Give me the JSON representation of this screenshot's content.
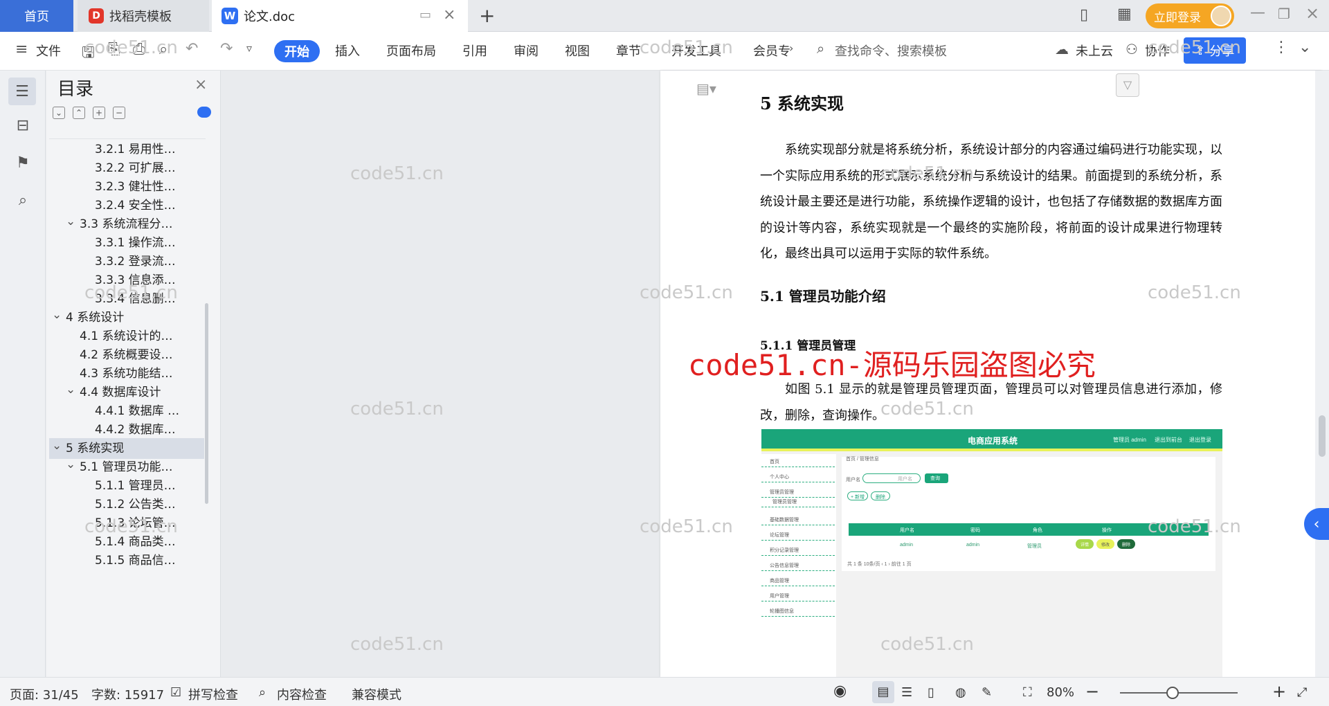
{
  "tabs": {
    "home": "首页",
    "daoke": "找稻壳模板",
    "doc": "论文.doc",
    "new_tab": "+",
    "login": "立即登录"
  },
  "toolbar": {
    "file_menu": "文件",
    "ribbon": [
      "开始",
      "插入",
      "页面布局",
      "引用",
      "审阅",
      "视图",
      "章节",
      "开发工具",
      "会员专"
    ],
    "search_placeholder": "查找命令、搜索模板",
    "cloud": "未上云",
    "collab": "协作",
    "share": "分享"
  },
  "toc": {
    "title": "目录",
    "items": [
      {
        "label": "3.2.1  易用性…",
        "level": 3
      },
      {
        "label": "3.2.2  可扩展…",
        "level": 3
      },
      {
        "label": "3.2.3  健壮性…",
        "level": 3
      },
      {
        "label": "3.2.4  安全性…",
        "level": 3
      },
      {
        "label": "3.3  系统流程分…",
        "level": 2,
        "expanded": true
      },
      {
        "label": "3.3.1  操作流…",
        "level": 3
      },
      {
        "label": "3.3.2  登录流…",
        "level": 3
      },
      {
        "label": "3.3.3  信息添…",
        "level": 3
      },
      {
        "label": "3.3.4  信息删…",
        "level": 3
      },
      {
        "label": "4  系统设计",
        "level": 1,
        "expanded": true
      },
      {
        "label": "4.1  系统设计的…",
        "level": 2
      },
      {
        "label": "4.2  系统概要设…",
        "level": 2
      },
      {
        "label": "4.3  系统功能结…",
        "level": 2
      },
      {
        "label": "4.4  数据库设计",
        "level": 2,
        "expanded": true
      },
      {
        "label": "4.4.1  数据库 …",
        "level": 3
      },
      {
        "label": "4.4.2  数据库…",
        "level": 3
      },
      {
        "label": "5  系统实现",
        "level": 1,
        "expanded": true,
        "active": true
      },
      {
        "label": "5.1  管理员功能…",
        "level": 2,
        "expanded": true
      },
      {
        "label": "5.1.1  管理员…",
        "level": 3
      },
      {
        "label": "5.1.2  公告类…",
        "level": 3
      },
      {
        "label": "5.1.3  论坛管…",
        "level": 3
      },
      {
        "label": "5.1.4  商品类…",
        "level": 3
      },
      {
        "label": "5.1.5  商品信…",
        "level": 3
      }
    ]
  },
  "doc": {
    "h1": "5  系统实现",
    "para1": "系统实现部分就是将系统分析，系统设计部分的内容通过编码进行功能实现，以一个实际应用系统的形式展示系统分析与系统设计的结果。前面提到的系统分析，系统设计最主要还是进行功能，系统操作逻辑的设计，也包括了存储数据的数据库方面的设计等内容，系统实现就是一个最终的实施阶段，将前面的设计成果进行物理转化，最终出具可以运用于实际的软件系统。",
    "h2": "5.1  管理员功能介绍",
    "h3": "5.1.1  管理员管理",
    "para2": "如图 5.1 显示的就是管理员管理页面，管理员可以对管理员信息进行添加，修改，删除，查询操作。",
    "red_watermark": "code51.cn-源码乐园盗图必究",
    "watermark": "code51.cn"
  },
  "shot": {
    "title": "电商应用系统",
    "top_user": "管理员 admin",
    "top_front": "退出到前台",
    "top_logout": "退出登录",
    "breadcrumb": "首页 / 管理信息",
    "search_label": "用户名",
    "search_placeholder": "用户名",
    "search_btn": "查询",
    "add_btn": "+ 新增",
    "del_btn": "删除",
    "side": [
      "首页",
      "个人中心",
      "管理员管理",
      "管理员管理",
      "基础数据管理",
      "论坛管理",
      "积分记录管理",
      "公告信息管理",
      "商品管理",
      "用户管理",
      "轮播图信息"
    ],
    "headers": [
      "用户名",
      "密码",
      "角色",
      "操作"
    ],
    "row": [
      "admin",
      "admin",
      "管理员"
    ],
    "row_btns": [
      "详情",
      "修改",
      "删除"
    ],
    "pager": "共 1 条  10条/页  ‹  1  ›  前往  1  页"
  },
  "status": {
    "page": "页面: 31/45",
    "words": "字数: 15917",
    "spell": "拼写检查",
    "content": "内容检查",
    "compat": "兼容模式",
    "zoom": "80%"
  },
  "colors": {
    "accent": "#2e6ff2",
    "login": "#f5a623",
    "shot_green": "#1aa57a",
    "red_wm": "#e02020"
  }
}
